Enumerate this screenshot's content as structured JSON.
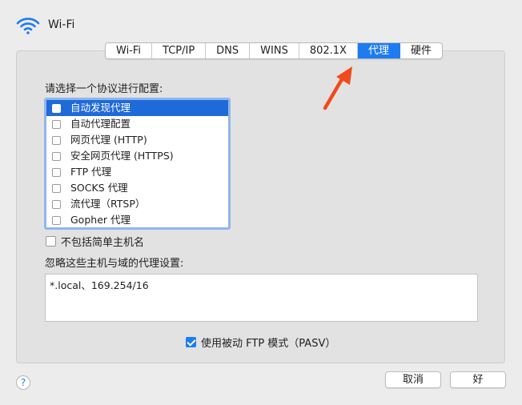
{
  "header": {
    "title": "Wi-Fi",
    "icon": "wifi-icon"
  },
  "tabs": [
    {
      "label": "Wi-Fi",
      "active": false
    },
    {
      "label": "TCP/IP",
      "active": false
    },
    {
      "label": "DNS",
      "active": false
    },
    {
      "label": "WINS",
      "active": false
    },
    {
      "label": "802.1X",
      "active": false
    },
    {
      "label": "代理",
      "active": true
    },
    {
      "label": "硬件",
      "active": false
    }
  ],
  "protocol_section": {
    "label": "请选择一个协议进行配置:",
    "items": [
      {
        "label": "自动发现代理",
        "checked": false,
        "selected": true
      },
      {
        "label": "自动代理配置",
        "checked": false,
        "selected": false
      },
      {
        "label": "网页代理 (HTTP)",
        "checked": false,
        "selected": false
      },
      {
        "label": "安全网页代理 (HTTPS)",
        "checked": false,
        "selected": false
      },
      {
        "label": "FTP 代理",
        "checked": false,
        "selected": false
      },
      {
        "label": "SOCKS 代理",
        "checked": false,
        "selected": false
      },
      {
        "label": "流代理（RTSP）",
        "checked": false,
        "selected": false
      },
      {
        "label": "Gopher 代理",
        "checked": false,
        "selected": false
      }
    ]
  },
  "exclude_simple_hostnames": {
    "label": "不包括简单主机名",
    "checked": false
  },
  "bypass": {
    "label": "忽略这些主机与域的代理设置:",
    "value": "*.local、169.254/16"
  },
  "passive_ftp": {
    "label": "使用被动 FTP 模式（PASV）",
    "checked": true
  },
  "footer": {
    "help": "?",
    "cancel_label": "取消",
    "ok_label": "好"
  },
  "colors": {
    "accent": "#1d7cf2",
    "selection": "#1f6ad9",
    "annotation_arrow": "#f24a1d"
  }
}
